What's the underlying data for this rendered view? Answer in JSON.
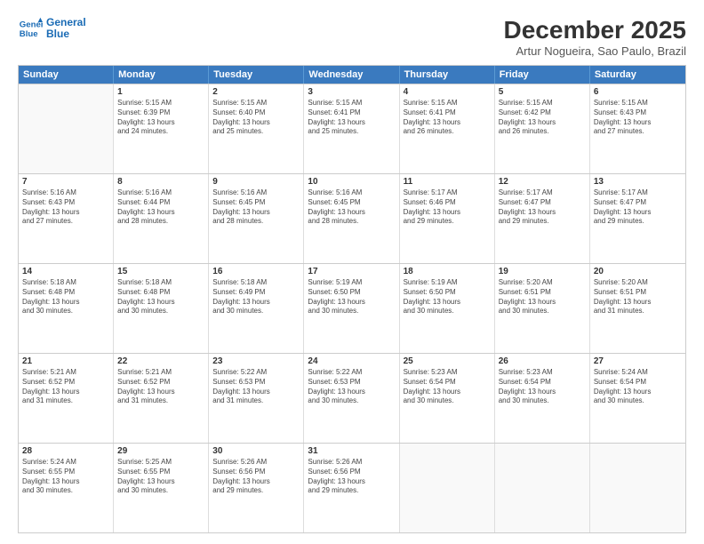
{
  "header": {
    "logo_line1": "General",
    "logo_line2": "Blue",
    "title": "December 2025",
    "subtitle": "Artur Nogueira, Sao Paulo, Brazil"
  },
  "days_of_week": [
    "Sunday",
    "Monday",
    "Tuesday",
    "Wednesday",
    "Thursday",
    "Friday",
    "Saturday"
  ],
  "weeks": [
    [
      {
        "day": "",
        "text": ""
      },
      {
        "day": "1",
        "text": "Sunrise: 5:15 AM\nSunset: 6:39 PM\nDaylight: 13 hours\nand 24 minutes."
      },
      {
        "day": "2",
        "text": "Sunrise: 5:15 AM\nSunset: 6:40 PM\nDaylight: 13 hours\nand 25 minutes."
      },
      {
        "day": "3",
        "text": "Sunrise: 5:15 AM\nSunset: 6:41 PM\nDaylight: 13 hours\nand 25 minutes."
      },
      {
        "day": "4",
        "text": "Sunrise: 5:15 AM\nSunset: 6:41 PM\nDaylight: 13 hours\nand 26 minutes."
      },
      {
        "day": "5",
        "text": "Sunrise: 5:15 AM\nSunset: 6:42 PM\nDaylight: 13 hours\nand 26 minutes."
      },
      {
        "day": "6",
        "text": "Sunrise: 5:15 AM\nSunset: 6:43 PM\nDaylight: 13 hours\nand 27 minutes."
      }
    ],
    [
      {
        "day": "7",
        "text": "Sunrise: 5:16 AM\nSunset: 6:43 PM\nDaylight: 13 hours\nand 27 minutes."
      },
      {
        "day": "8",
        "text": "Sunrise: 5:16 AM\nSunset: 6:44 PM\nDaylight: 13 hours\nand 28 minutes."
      },
      {
        "day": "9",
        "text": "Sunrise: 5:16 AM\nSunset: 6:45 PM\nDaylight: 13 hours\nand 28 minutes."
      },
      {
        "day": "10",
        "text": "Sunrise: 5:16 AM\nSunset: 6:45 PM\nDaylight: 13 hours\nand 28 minutes."
      },
      {
        "day": "11",
        "text": "Sunrise: 5:17 AM\nSunset: 6:46 PM\nDaylight: 13 hours\nand 29 minutes."
      },
      {
        "day": "12",
        "text": "Sunrise: 5:17 AM\nSunset: 6:47 PM\nDaylight: 13 hours\nand 29 minutes."
      },
      {
        "day": "13",
        "text": "Sunrise: 5:17 AM\nSunset: 6:47 PM\nDaylight: 13 hours\nand 29 minutes."
      }
    ],
    [
      {
        "day": "14",
        "text": "Sunrise: 5:18 AM\nSunset: 6:48 PM\nDaylight: 13 hours\nand 30 minutes."
      },
      {
        "day": "15",
        "text": "Sunrise: 5:18 AM\nSunset: 6:48 PM\nDaylight: 13 hours\nand 30 minutes."
      },
      {
        "day": "16",
        "text": "Sunrise: 5:18 AM\nSunset: 6:49 PM\nDaylight: 13 hours\nand 30 minutes."
      },
      {
        "day": "17",
        "text": "Sunrise: 5:19 AM\nSunset: 6:50 PM\nDaylight: 13 hours\nand 30 minutes."
      },
      {
        "day": "18",
        "text": "Sunrise: 5:19 AM\nSunset: 6:50 PM\nDaylight: 13 hours\nand 30 minutes."
      },
      {
        "day": "19",
        "text": "Sunrise: 5:20 AM\nSunset: 6:51 PM\nDaylight: 13 hours\nand 30 minutes."
      },
      {
        "day": "20",
        "text": "Sunrise: 5:20 AM\nSunset: 6:51 PM\nDaylight: 13 hours\nand 31 minutes."
      }
    ],
    [
      {
        "day": "21",
        "text": "Sunrise: 5:21 AM\nSunset: 6:52 PM\nDaylight: 13 hours\nand 31 minutes."
      },
      {
        "day": "22",
        "text": "Sunrise: 5:21 AM\nSunset: 6:52 PM\nDaylight: 13 hours\nand 31 minutes."
      },
      {
        "day": "23",
        "text": "Sunrise: 5:22 AM\nSunset: 6:53 PM\nDaylight: 13 hours\nand 31 minutes."
      },
      {
        "day": "24",
        "text": "Sunrise: 5:22 AM\nSunset: 6:53 PM\nDaylight: 13 hours\nand 30 minutes."
      },
      {
        "day": "25",
        "text": "Sunrise: 5:23 AM\nSunset: 6:54 PM\nDaylight: 13 hours\nand 30 minutes."
      },
      {
        "day": "26",
        "text": "Sunrise: 5:23 AM\nSunset: 6:54 PM\nDaylight: 13 hours\nand 30 minutes."
      },
      {
        "day": "27",
        "text": "Sunrise: 5:24 AM\nSunset: 6:54 PM\nDaylight: 13 hours\nand 30 minutes."
      }
    ],
    [
      {
        "day": "28",
        "text": "Sunrise: 5:24 AM\nSunset: 6:55 PM\nDaylight: 13 hours\nand 30 minutes."
      },
      {
        "day": "29",
        "text": "Sunrise: 5:25 AM\nSunset: 6:55 PM\nDaylight: 13 hours\nand 30 minutes."
      },
      {
        "day": "30",
        "text": "Sunrise: 5:26 AM\nSunset: 6:56 PM\nDaylight: 13 hours\nand 29 minutes."
      },
      {
        "day": "31",
        "text": "Sunrise: 5:26 AM\nSunset: 6:56 PM\nDaylight: 13 hours\nand 29 minutes."
      },
      {
        "day": "",
        "text": ""
      },
      {
        "day": "",
        "text": ""
      },
      {
        "day": "",
        "text": ""
      }
    ]
  ]
}
